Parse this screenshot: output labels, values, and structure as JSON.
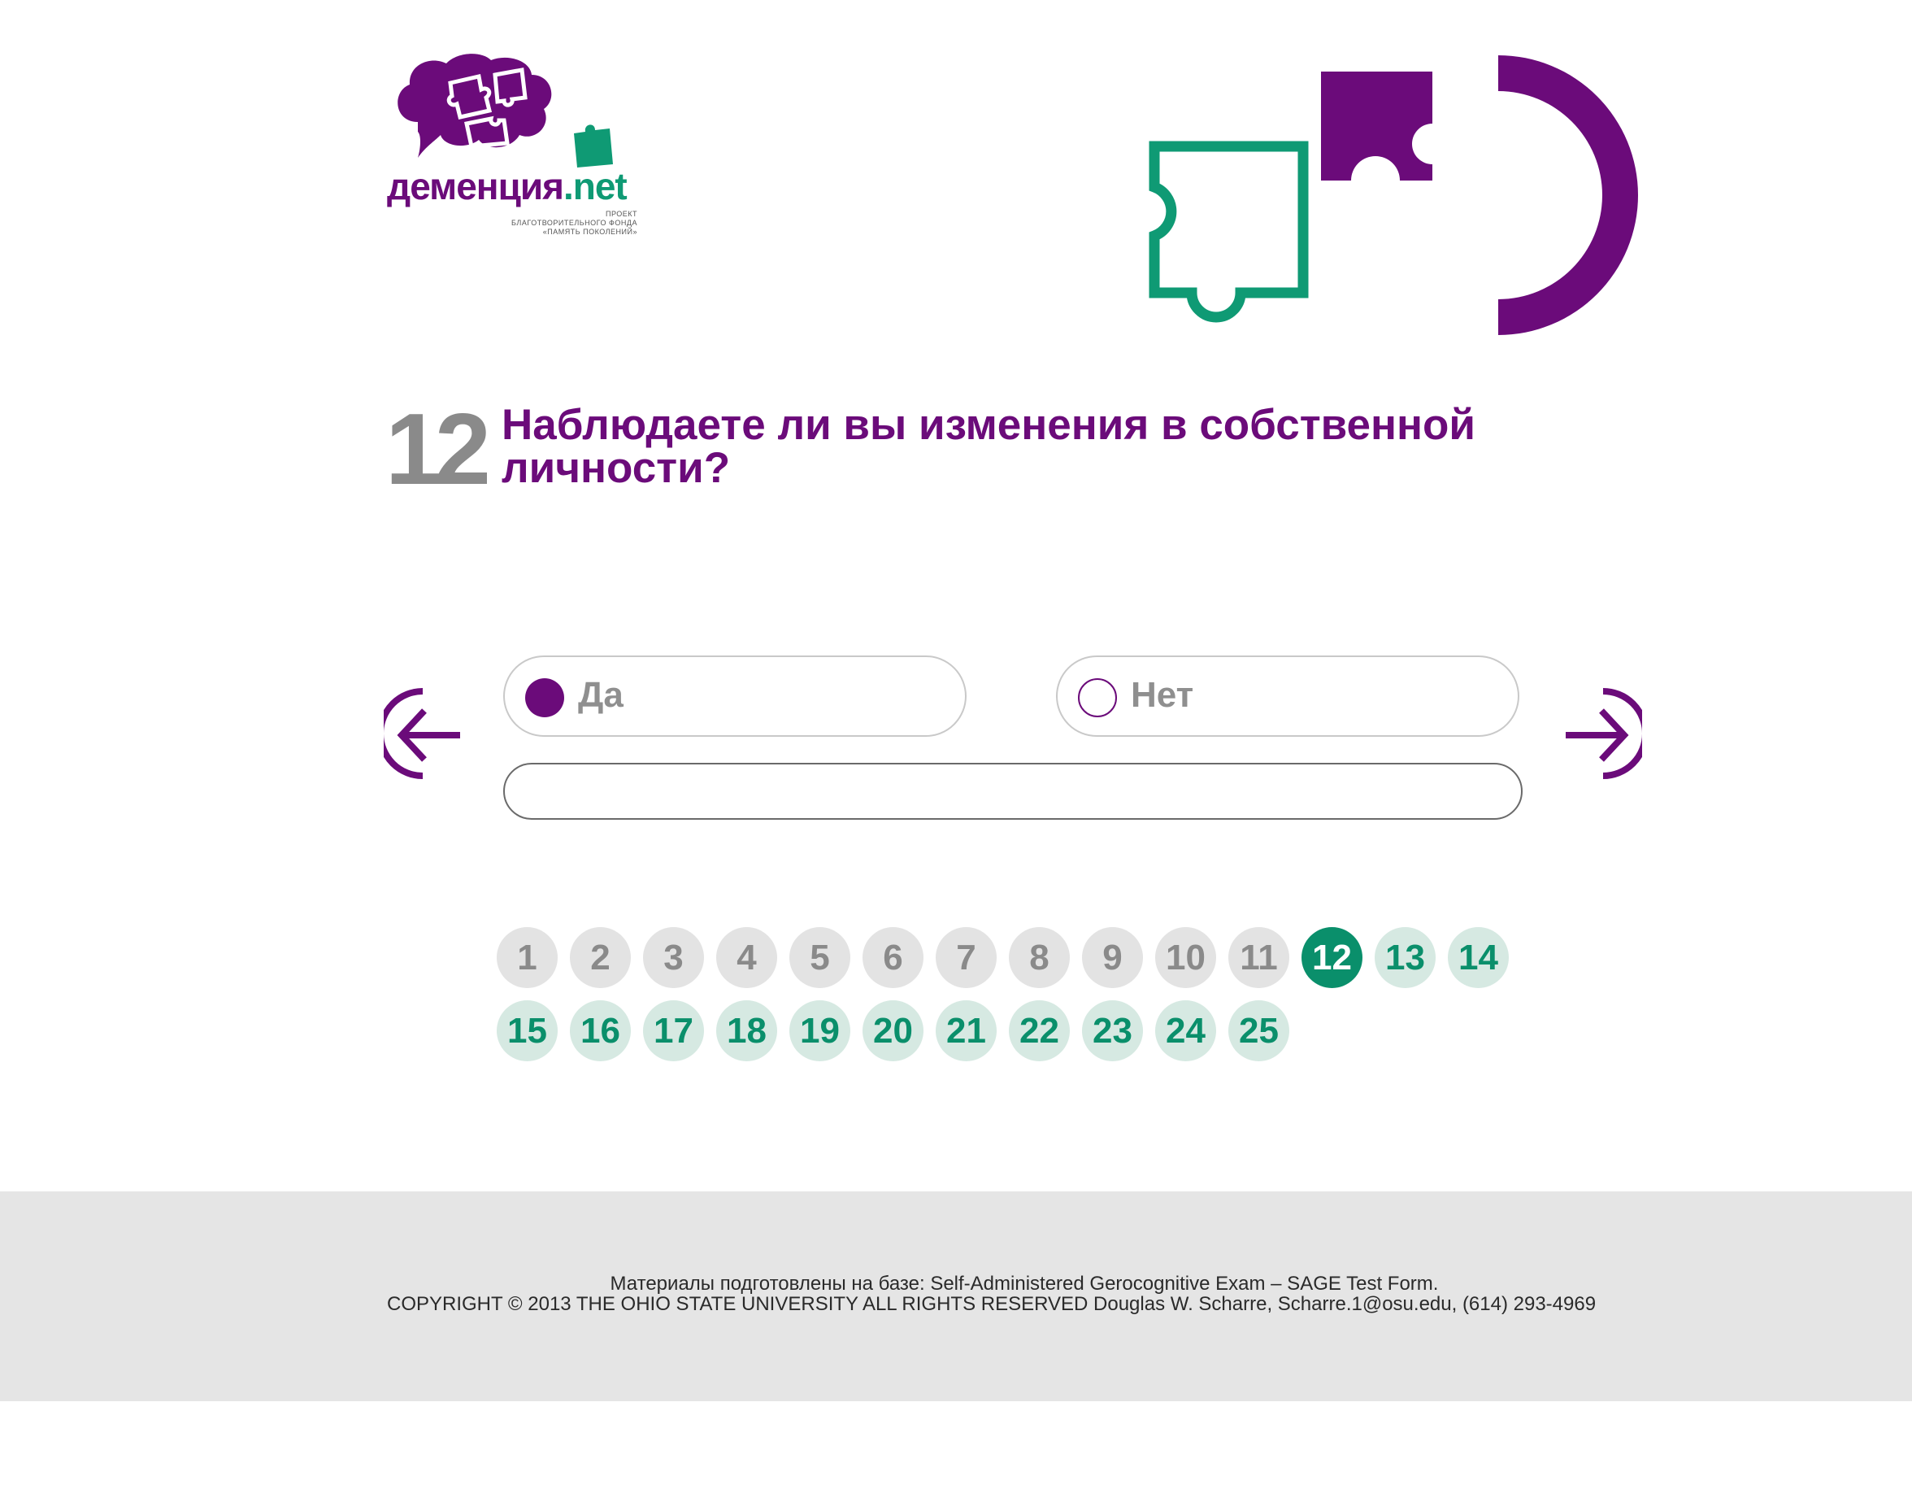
{
  "logo": {
    "name": "деменция",
    "domain": ".net",
    "subtitle_lines": [
      "ПРОЕКТ",
      "БЛАГОТВОРИТЕЛЬНОГО ФОНДА",
      "«ПАМЯТЬ ПОКОЛЕНИЙ»"
    ]
  },
  "question": {
    "number": "12",
    "text": "Наблюдаете ли вы изменения в собственной личности?"
  },
  "options": [
    {
      "label": "Да",
      "selected": true
    },
    {
      "label": "Нет",
      "selected": false
    }
  ],
  "answer_input": {
    "value": "",
    "placeholder": ""
  },
  "pagination": {
    "current": 12,
    "pages": [
      "1",
      "2",
      "3",
      "4",
      "5",
      "6",
      "7",
      "8",
      "9",
      "10",
      "11",
      "12",
      "13",
      "14",
      "15",
      "16",
      "17",
      "18",
      "19",
      "20",
      "21",
      "22",
      "23",
      "24",
      "25"
    ]
  },
  "footer": {
    "line1": "Материалы подготовлены на базе: Self-Administered Gerocognitive Exam – SAGE Test Form.",
    "line2": "COPYRIGHT © 2013 THE OHIO STATE UNIVERSITY ALL RIGHTS RESERVED Douglas W. Scharre, Scharre.1@osu.edu, (614) 293-4969"
  },
  "colors": {
    "brand_purple": "#6b0b7a",
    "brand_green": "#0a8f6b",
    "muted_gray": "#8a8a8a",
    "footer_bg": "#e5e5e5"
  },
  "icons": {
    "prev": "arrow-left-icon",
    "next": "arrow-right-icon"
  }
}
